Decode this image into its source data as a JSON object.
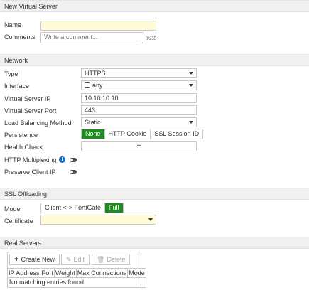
{
  "sections": {
    "new_virtual_server": "New Virtual Server",
    "network": "Network",
    "ssl_offloading": "SSL Offloading",
    "real_servers": "Real Servers"
  },
  "general": {
    "name_label": "Name",
    "name_value": "",
    "comments_label": "Comments",
    "comments_placeholder": "Write a comment...",
    "comments_counter": "0/255"
  },
  "network": {
    "type_label": "Type",
    "type_value": "HTTPS",
    "interface_label": "Interface",
    "interface_value": "any",
    "vip_label": "Virtual Server IP",
    "vip_value": "10.10.10.10",
    "port_label": "Virtual Server Port",
    "port_value": "443",
    "lb_label": "Load Balancing Method",
    "lb_value": "Static",
    "persistence_label": "Persistence",
    "persistence_options": [
      "None",
      "HTTP Cookie",
      "SSL Session ID"
    ],
    "persistence_selected": "None",
    "health_label": "Health Check",
    "health_add": "+",
    "multiplex_label": "HTTP Multiplexing",
    "multiplex_enabled": false,
    "preserve_label": "Preserve Client IP",
    "preserve_enabled": false
  },
  "ssl": {
    "mode_label": "Mode",
    "mode_options": [
      "Client <-> FortiGate",
      "Full"
    ],
    "mode_selected": "Full",
    "cert_label": "Certificate",
    "cert_value": ""
  },
  "real_servers": {
    "create_label": "Create New",
    "edit_label": "Edit",
    "delete_label": "Delete",
    "columns": [
      "IP Address",
      "Port",
      "Weight",
      "Max Connections",
      "Mode"
    ],
    "empty_text": "No matching entries found"
  },
  "colors": {
    "accent_green": "#1f8a1f",
    "required_field": "#fffbd6",
    "info_icon": "#1565c0"
  }
}
